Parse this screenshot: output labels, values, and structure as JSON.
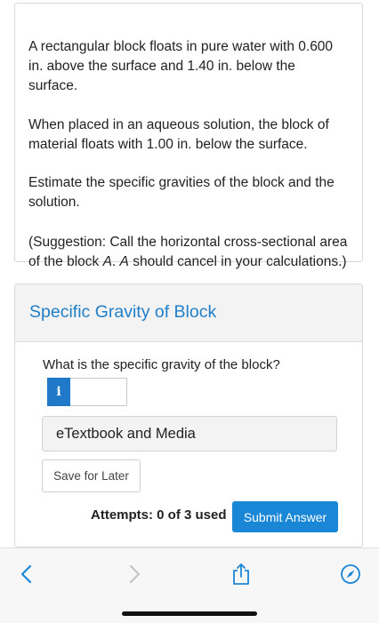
{
  "problem": {
    "p1": "A rectangular block floats in pure water with 0.600 in. above the surface and 1.40 in. below the surface.",
    "p2": "When placed in an aqueous solution, the block of material floats with 1.00 in. below the surface.",
    "p3": "Estimate the specific gravities of the block and the solution.",
    "p4_before": "(Suggestion: Call the horizontal cross-sectional area of the block ",
    "p4_var1": "A",
    "p4_mid": ". ",
    "p4_var2": "A",
    "p4_after": " should cancel in your calculations.)"
  },
  "part": {
    "title": "Specific Gravity of Block",
    "question": "What is the specific gravity of the block?",
    "info_icon": "i",
    "answer_value": "",
    "etextbook_label": "eTextbook and Media",
    "save_label": "Save for Later",
    "attempts_label": "Attempts: 0 of 3 used",
    "submit_label": "Submit Answer"
  },
  "browser_bar": {
    "icons": [
      "back-chevron-icon",
      "forward-chevron-icon",
      "share-icon",
      "compass-icon"
    ],
    "accent_color": "#1a86d6",
    "disabled_color": "#c4c4c4"
  }
}
